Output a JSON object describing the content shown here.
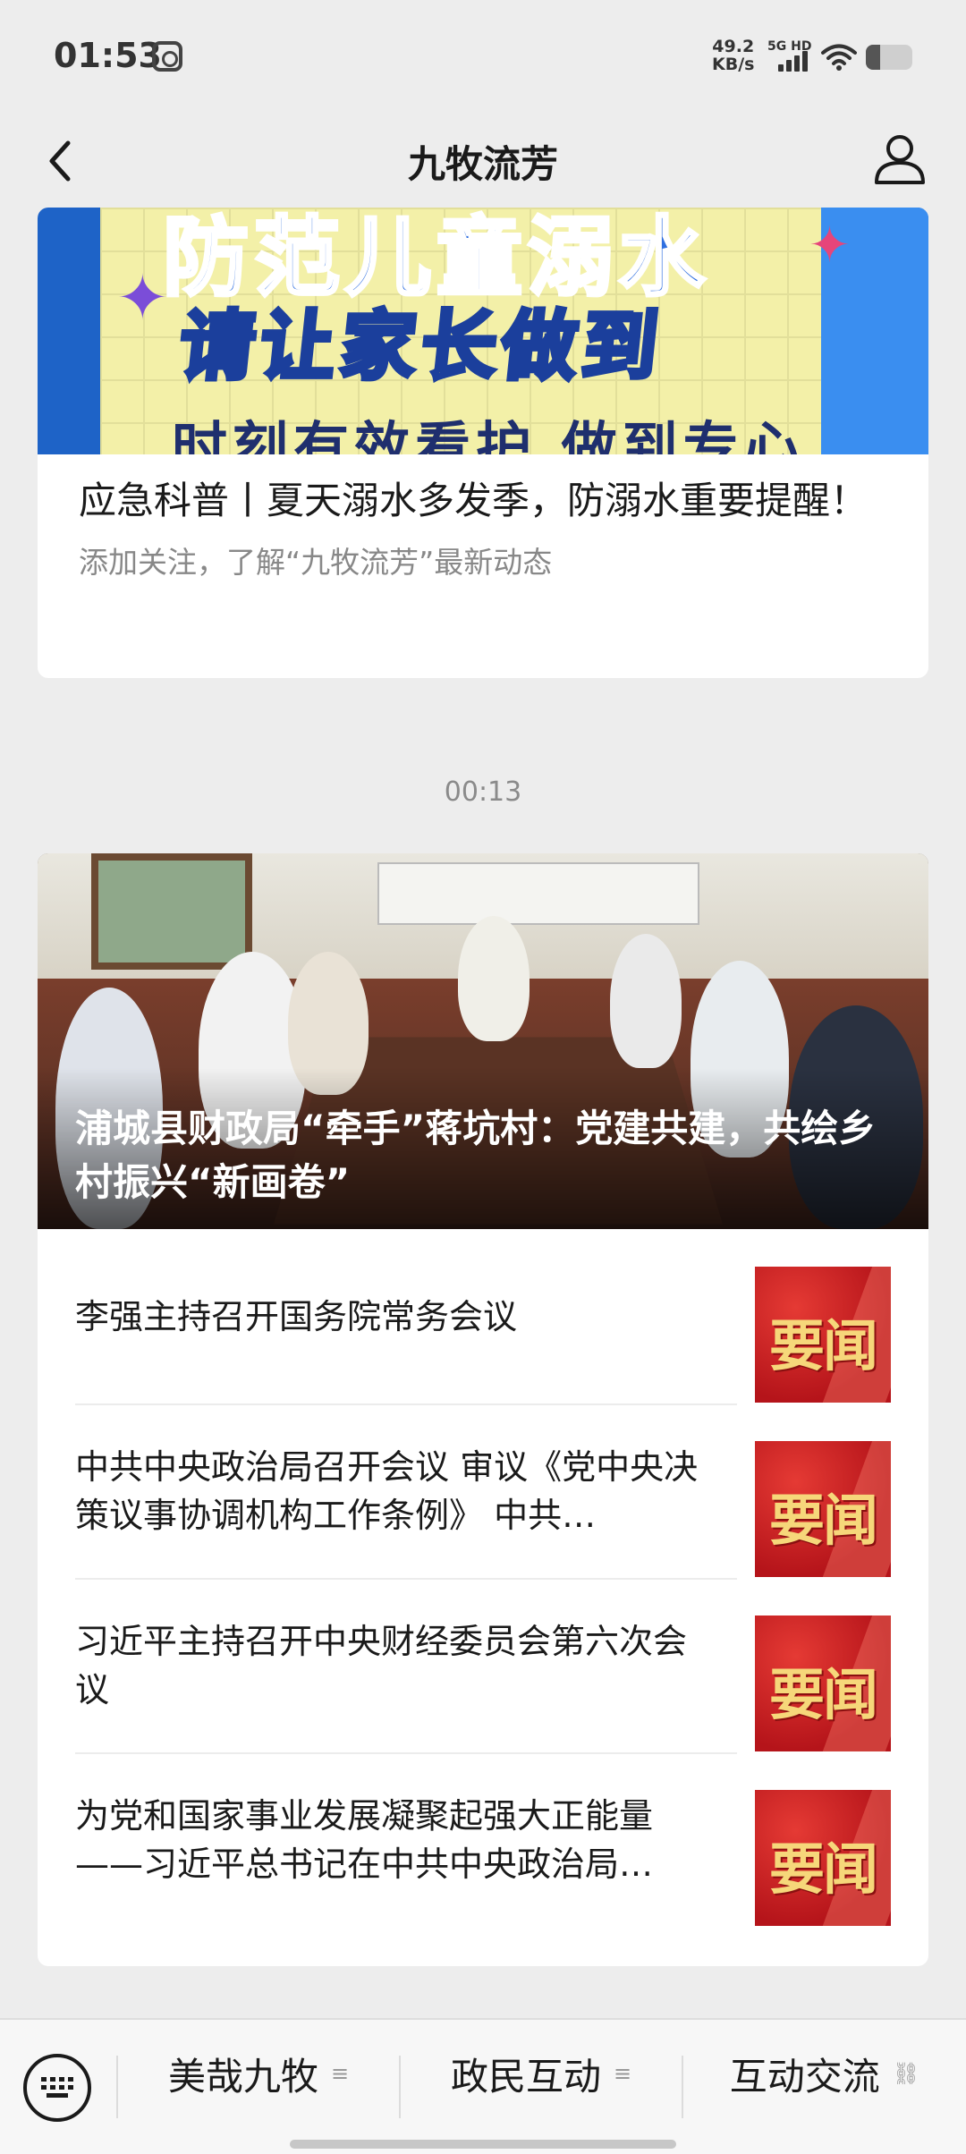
{
  "status_bar": {
    "time": "01:53",
    "speed_value": "49.2",
    "speed_unit": "KB/s",
    "network": "5G HD",
    "battery_level": 0.3
  },
  "nav": {
    "title": "九牧流芳",
    "back_icon": "back-arrow-icon",
    "profile_icon": "person-icon"
  },
  "article_card": {
    "poster_lines": [
      "防范儿童溺水",
      "请让家长做到",
      "时刻有效看护 做到专心"
    ],
    "title": "应急科普丨夏天溺水多发季，防溺水重要提醒！",
    "subtitle": "添加关注，了解“九牧流芳”最新动态"
  },
  "timestamp": "00:13",
  "news_card": {
    "hero_title": "浦城县财政局“牵手”蒋坑村：党建共建，共绘乡村振兴“新画卷”",
    "items": [
      {
        "title": "李强主持召开国务院常务会议",
        "thumb_label": "要闻"
      },
      {
        "title": "中共中央政治局召开会议 审议《党中央决策议事协调机构工作条例》 中共…",
        "thumb_label": "要闻"
      },
      {
        "title": "习近平主持召开中央财经委员会第六次会议",
        "thumb_label": "要闻"
      },
      {
        "title": "为党和国家事业发展凝聚起强大正能量——习近平总书记在中共中央政治局…",
        "thumb_label": "要闻"
      }
    ]
  },
  "bottom_menu": {
    "keyboard_icon": "keyboard-icon",
    "items": [
      {
        "label": "美哉九牧",
        "icon": "menu-lines-icon"
      },
      {
        "label": "政民互动",
        "icon": "menu-lines-icon"
      },
      {
        "label": "互动交流",
        "icon": "link-icon"
      }
    ]
  },
  "colors": {
    "background": "#ededed",
    "card": "#ffffff",
    "thumb_red": "#c4161c",
    "thumb_gold": "#f6d77a"
  }
}
